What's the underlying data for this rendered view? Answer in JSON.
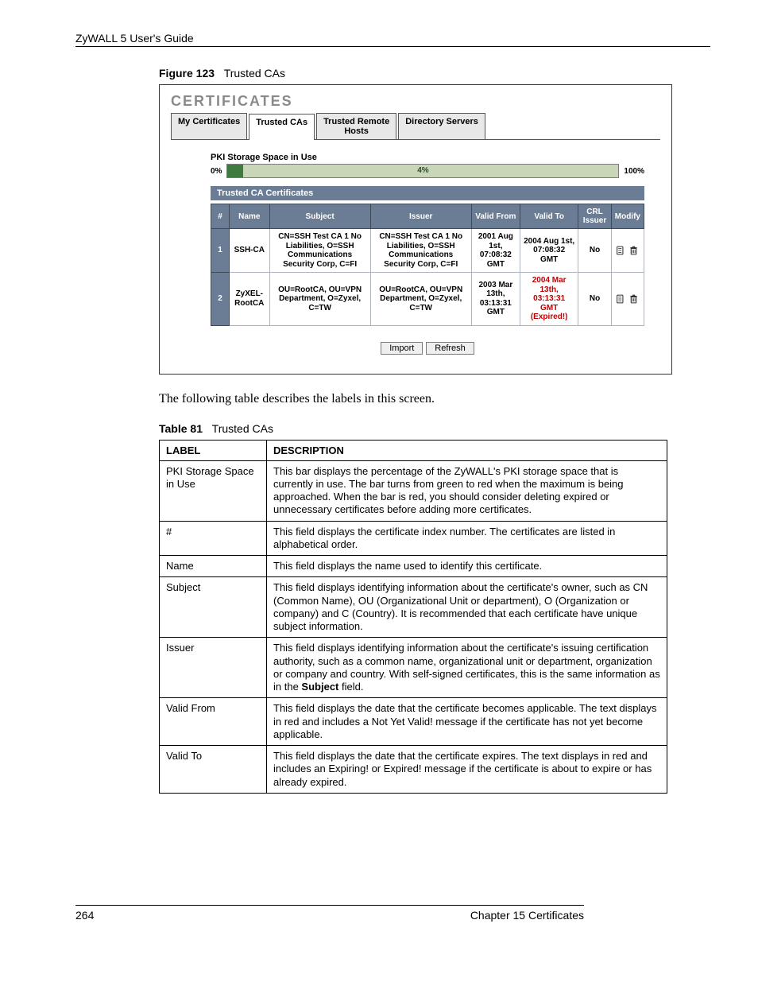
{
  "doc": {
    "guide_title": "ZyWALL 5 User's Guide",
    "page_number": "264",
    "chapter": "Chapter 15 Certificates"
  },
  "figure": {
    "number": "Figure 123",
    "title": "Trusted CAs"
  },
  "screenshot": {
    "title": "CERTIFICATES",
    "tabs": {
      "my_certs": "My Certificates",
      "trusted_cas": "Trusted CAs",
      "trusted_remote_l1": "Trusted Remote",
      "trusted_remote_l2": "Hosts",
      "dir_servers": "Directory Servers"
    },
    "pki": {
      "label": "PKI Storage Space in Use",
      "left": "0%",
      "percent": "4%",
      "right": "100%"
    },
    "section_title": "Trusted CA Certificates",
    "columns": {
      "idx": "#",
      "name": "Name",
      "subject": "Subject",
      "issuer": "Issuer",
      "valid_from": "Valid From",
      "valid_to": "Valid To",
      "crl": "CRL Issuer",
      "modify": "Modify"
    },
    "rows": [
      {
        "idx": "1",
        "name": "SSH-CA",
        "subject": "CN=SSH Test CA 1 No Liabilities, O=SSH Communications Security Corp, C=FI",
        "issuer": "CN=SSH Test CA 1 No Liabilities, O=SSH Communications Security Corp, C=FI",
        "valid_from": "2001 Aug 1st, 07:08:32 GMT",
        "valid_to": "2004 Aug 1st, 07:08:32 GMT",
        "crl": "No",
        "expired": false
      },
      {
        "idx": "2",
        "name": "ZyXEL-RootCA",
        "subject": "OU=RootCA, OU=VPN Department, O=Zyxel, C=TW",
        "issuer": "OU=RootCA, OU=VPN Department, O=Zyxel, C=TW",
        "valid_from": "2003 Mar 13th, 03:13:31 GMT",
        "valid_to": "2004 Mar 13th, 03:13:31 GMT (Expired!)",
        "crl": "No",
        "expired": true
      }
    ],
    "buttons": {
      "import": "Import",
      "refresh": "Refresh"
    }
  },
  "intro_text": "The following table describes the labels in this screen.",
  "table81": {
    "number": "Table 81",
    "title": "Trusted CAs",
    "head_label": "LABEL",
    "head_desc": "DESCRIPTION",
    "rows": [
      {
        "label": "PKI Storage Space in Use",
        "desc": "This bar displays the percentage of the ZyWALL's PKI storage space that is currently in use. The bar turns from green to red when the maximum is being approached. When the bar is red, you should consider deleting expired or unnecessary certificates before adding more certificates."
      },
      {
        "label": "#",
        "desc": "This field displays the certificate index number. The certificates are listed in alphabetical order."
      },
      {
        "label": "Name",
        "desc": "This field displays the name used to identify this certificate."
      },
      {
        "label": "Subject",
        "desc": "This field displays identifying information about the certificate's owner, such as CN (Common Name), OU (Organizational Unit or department), O (Organization or company) and C (Country). It is recommended that each certificate have unique subject information."
      },
      {
        "label": "Issuer",
        "desc_html": "This field displays identifying information about the certificate's issuing certification authority, such as a common name, organizational unit or department, organization or company and country. With self-signed certificates, this is the same information as in the <b>Subject</b> field."
      },
      {
        "label": "Valid From",
        "desc": "This field displays the date that the certificate becomes applicable. The text displays in red and includes a Not Yet Valid! message if the certificate has not yet become applicable."
      },
      {
        "label": "Valid To",
        "desc": "This field displays the date that the certificate expires. The text displays in red and includes an Expiring! or Expired! message if the certificate is about to expire or has already expired."
      }
    ]
  }
}
